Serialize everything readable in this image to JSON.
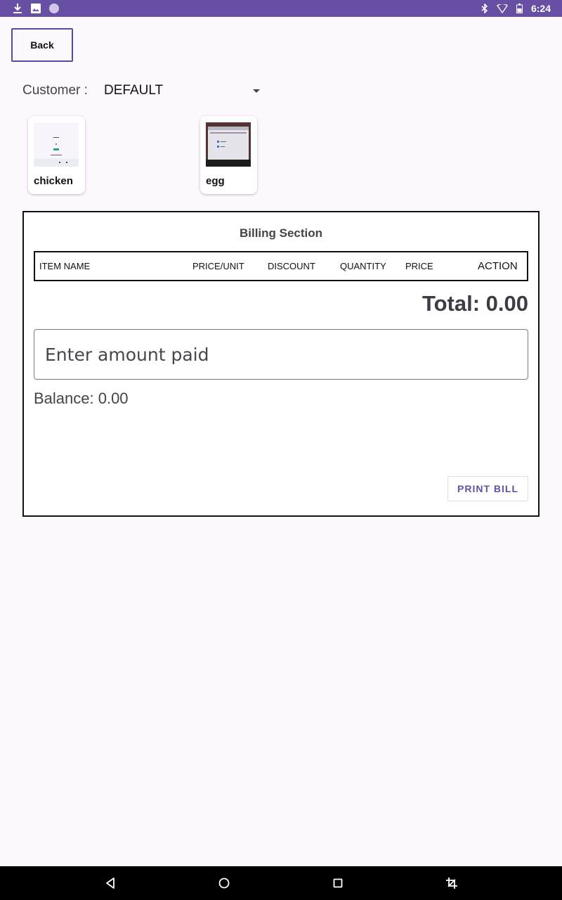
{
  "status_bar": {
    "time": "6:24",
    "left_icons": [
      "download-icon",
      "image-icon",
      "circle-notification-icon"
    ],
    "right_icons": [
      "bluetooth-icon",
      "wifi-icon",
      "battery-icon"
    ]
  },
  "header": {
    "back_label": "Back"
  },
  "customer": {
    "label": "Customer :",
    "selected": "DEFAULT"
  },
  "products": [
    {
      "name": "chicken",
      "thumbnail": "screenshot-thumbnail-light"
    },
    {
      "name": "egg",
      "thumbnail": "screenshot-thumbnail-dark"
    }
  ],
  "billing": {
    "title": "Billing Section",
    "columns": [
      "ITEM NAME",
      "PRICE/UNIT",
      "DISCOUNT",
      "QUANTITY",
      "PRICE",
      "ACTION"
    ],
    "total_text": "Total: 0.00",
    "amount_placeholder": "Enter amount paid",
    "balance_text": "Balance: 0.00",
    "print_label": "PRINT BILL"
  },
  "nav": {
    "icons": [
      "back-triangle-icon",
      "home-circle-icon",
      "recents-square-icon",
      "screenshot-crop-icon"
    ]
  },
  "colors": {
    "accent": "#6750a4",
    "background": "#fdf7fe",
    "nav_bar": "#000000"
  }
}
